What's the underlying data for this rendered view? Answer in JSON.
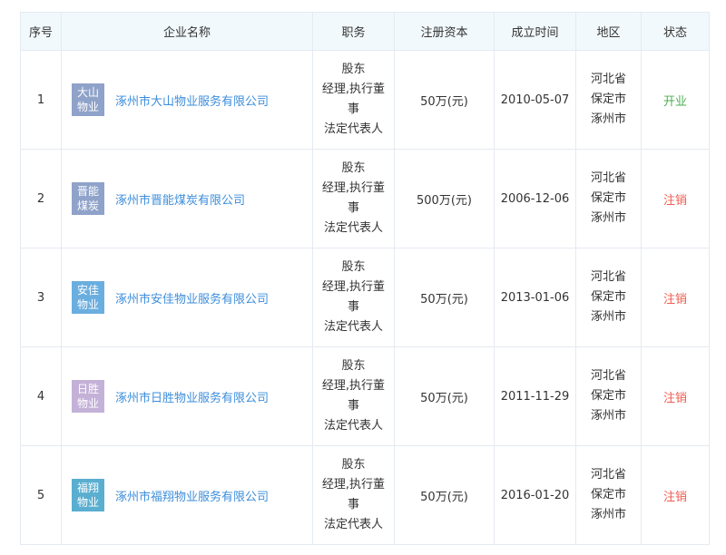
{
  "table": {
    "headers": [
      "序号",
      "企业名称",
      "职务",
      "注册资本",
      "成立时间",
      "地区",
      "状态"
    ],
    "rows": [
      {
        "index": "1",
        "logo_line1": "大山",
        "logo_line2": "物业",
        "logo_color": "#8fa2c9",
        "company": "涿州市大山物业服务有限公司",
        "role_lines": [
          "股东",
          "经理,执行董",
          "事",
          "法定代表人"
        ],
        "capital": "50万(元)",
        "founded": "2010-05-07",
        "region_lines": [
          "河北省",
          "保定市",
          "涿州市"
        ],
        "status": "开业",
        "status_color": "#4caf50"
      },
      {
        "index": "2",
        "logo_line1": "晋能",
        "logo_line2": "煤炭",
        "logo_color": "#8fa2c9",
        "company": "涿州市晋能煤炭有限公司",
        "role_lines": [
          "股东",
          "经理,执行董",
          "事",
          "法定代表人"
        ],
        "capital": "500万(元)",
        "founded": "2006-12-06",
        "region_lines": [
          "河北省",
          "保定市",
          "涿州市"
        ],
        "status": "注销",
        "status_color": "#f25a4f"
      },
      {
        "index": "3",
        "logo_line1": "安佳",
        "logo_line2": "物业",
        "logo_color": "#6aaee0",
        "company": "涿州市安佳物业服务有限公司",
        "role_lines": [
          "股东",
          "经理,执行董",
          "事",
          "法定代表人"
        ],
        "capital": "50万(元)",
        "founded": "2013-01-06",
        "region_lines": [
          "河北省",
          "保定市",
          "涿州市"
        ],
        "status": "注销",
        "status_color": "#f25a4f"
      },
      {
        "index": "4",
        "logo_line1": "日胜",
        "logo_line2": "物业",
        "logo_color": "#c4b1d8",
        "company": "涿州市日胜物业服务有限公司",
        "role_lines": [
          "股东",
          "经理,执行董",
          "事",
          "法定代表人"
        ],
        "capital": "50万(元)",
        "founded": "2011-11-29",
        "region_lines": [
          "河北省",
          "保定市",
          "涿州市"
        ],
        "status": "注销",
        "status_color": "#f25a4f"
      },
      {
        "index": "5",
        "logo_line1": "福翔",
        "logo_line2": "物业",
        "logo_color": "#5aaed0",
        "company": "涿州市福翔物业服务有限公司",
        "role_lines": [
          "股东",
          "经理,执行董",
          "事",
          "法定代表人"
        ],
        "capital": "50万(元)",
        "founded": "2016-01-20",
        "region_lines": [
          "河北省",
          "保定市",
          "涿州市"
        ],
        "status": "注销",
        "status_color": "#f25a4f"
      }
    ]
  }
}
